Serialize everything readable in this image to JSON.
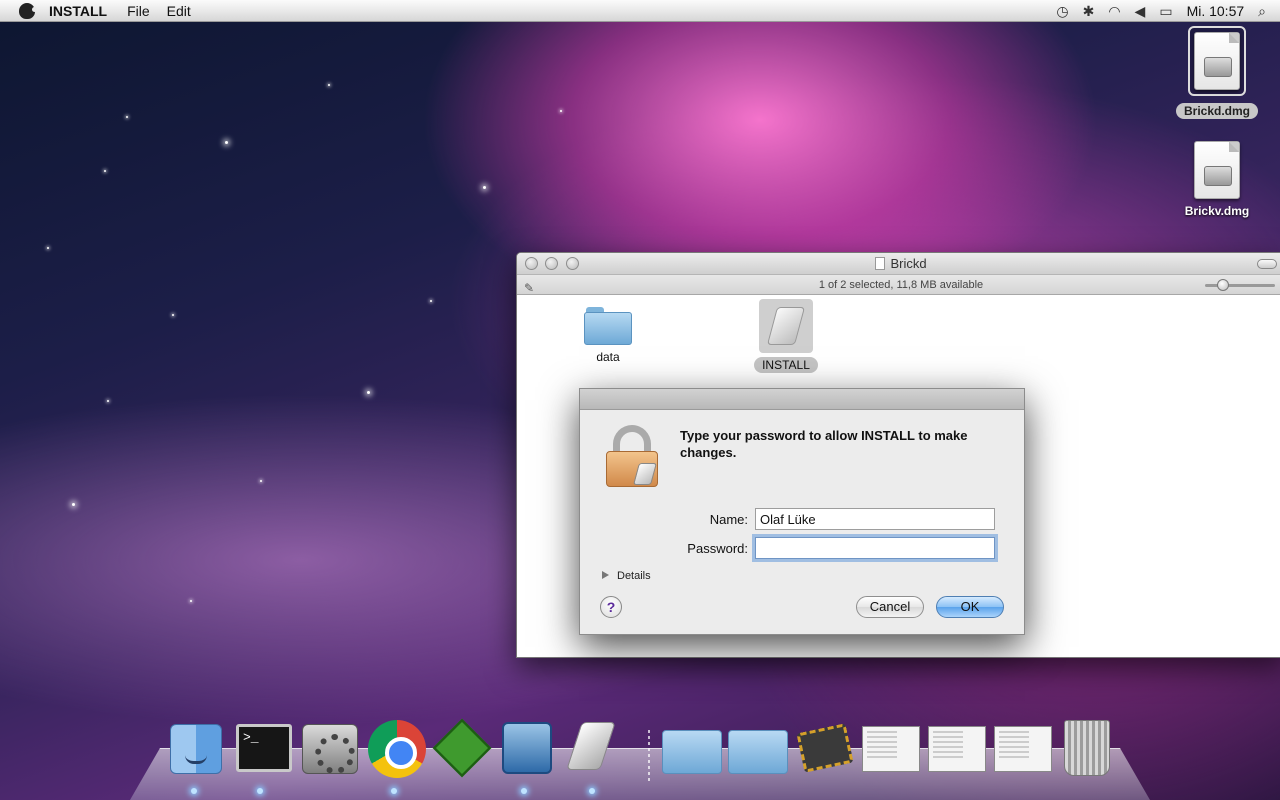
{
  "menubar": {
    "app_name": "INSTALL",
    "menus": [
      "File",
      "Edit"
    ],
    "status_icons": [
      "time-machine-icon",
      "bluetooth-icon",
      "wifi-icon",
      "volume-icon",
      "battery-icon"
    ],
    "clock": "Mi. 10:57"
  },
  "desktop": {
    "icons": [
      {
        "label": "Brickd.dmg",
        "selected": true
      },
      {
        "label": "Brickv.dmg",
        "selected": false
      }
    ]
  },
  "finder": {
    "title": "Brickd",
    "status": "1 of 2 selected, 11,8 MB available",
    "items": [
      {
        "label": "data",
        "kind": "folder"
      },
      {
        "label": "INSTALL",
        "kind": "installer",
        "selected": true
      }
    ]
  },
  "auth_dialog": {
    "message": "Type your password to allow INSTALL to make changes.",
    "name_label": "Name:",
    "name_value": "Olaf Lüke",
    "password_label": "Password:",
    "password_value": "",
    "details_label": "Details",
    "help_label": "?",
    "cancel_label": "Cancel",
    "ok_label": "OK"
  },
  "dock": {
    "apps": [
      "Finder",
      "Terminal",
      "System Preferences",
      "Google Chrome",
      "MacVim",
      "VirtualBox",
      "Installer"
    ],
    "stacks": [
      "Applications",
      "Documents",
      "Brick",
      "Screenshot 1",
      "Screenshot 2",
      "Screenshot 3",
      "Trash"
    ],
    "terminal_prompt": ">_"
  },
  "colors": {
    "accent": "#5aa2eb",
    "selection_gray": "#c4c4c4"
  }
}
